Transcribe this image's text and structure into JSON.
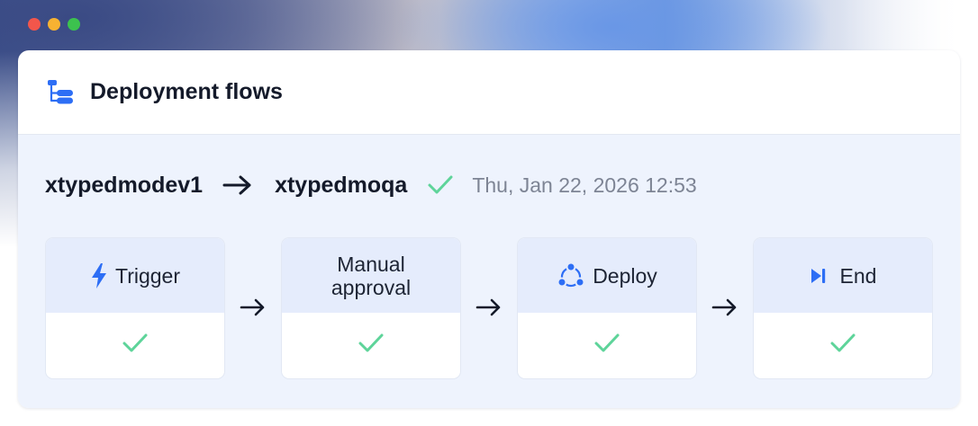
{
  "window": {
    "title": "Deployment flows",
    "icon": "flow-tree-icon",
    "controls": [
      "close",
      "minimize",
      "zoom"
    ]
  },
  "flow": {
    "source": "xtypedmodev1",
    "target": "xtypedmoqa",
    "status_icon": "check-icon",
    "timestamp": "Thu, Jan 22, 2026 12:53"
  },
  "stages": [
    {
      "label": "Trigger",
      "icon": "lightning-icon",
      "status_icon": "check-icon"
    },
    {
      "label": "Manual\napproval",
      "icon": "",
      "status_icon": "check-icon"
    },
    {
      "label": "Deploy",
      "icon": "deploy-nodes-icon",
      "status_icon": "check-icon"
    },
    {
      "label": "End",
      "icon": "skip-end-icon",
      "status_icon": "check-icon"
    }
  ],
  "colors": {
    "accent": "#2d6ef5",
    "success": "#5ed49a",
    "text": "#141a2a",
    "muted": "#7d8494",
    "stage_header": "#e5ecfc",
    "panel": "#eef3fd"
  }
}
